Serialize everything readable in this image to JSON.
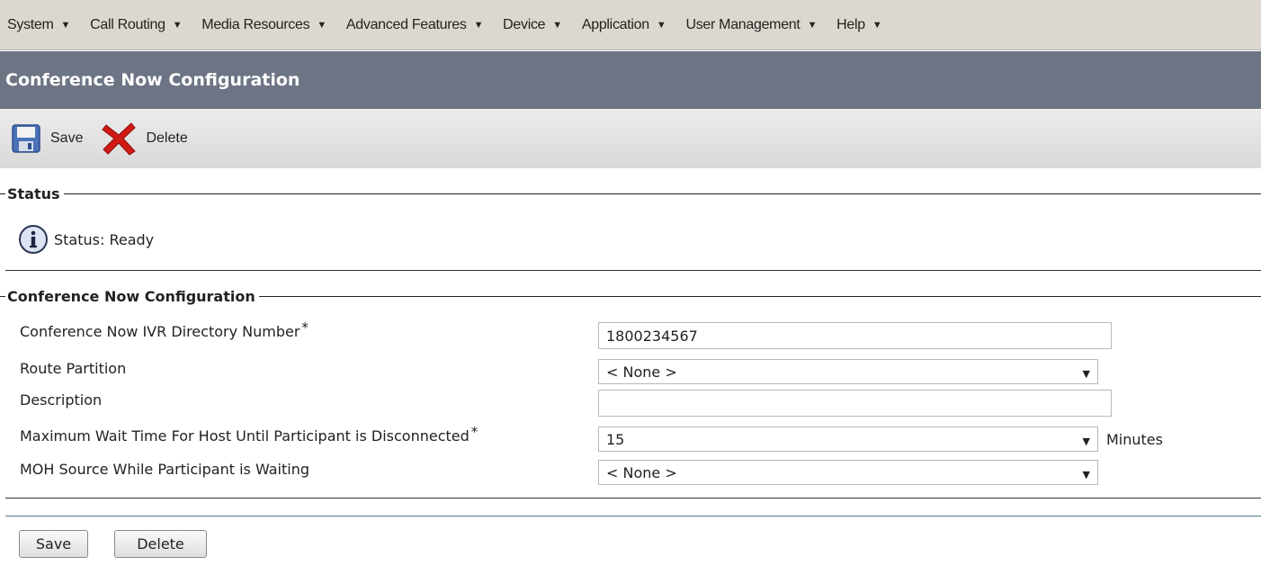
{
  "menubar": {
    "items": [
      {
        "label": "System"
      },
      {
        "label": "Call Routing"
      },
      {
        "label": "Media Resources"
      },
      {
        "label": "Advanced Features"
      },
      {
        "label": "Device"
      },
      {
        "label": "Application"
      },
      {
        "label": "User Management"
      },
      {
        "label": "Help"
      }
    ],
    "caret": "▼"
  },
  "page_title": "Conference Now Configuration",
  "toolbar": {
    "save_label": "Save",
    "delete_label": "Delete"
  },
  "status_section": {
    "legend": "Status",
    "status_text": "Status: Ready"
  },
  "config_section": {
    "legend": "Conference Now Configuration",
    "required_mark": "*",
    "fields": {
      "ivr_dn": {
        "label": "Conference Now IVR Directory Number",
        "value": "1800234567"
      },
      "route_partition": {
        "label": "Route Partition",
        "value": "< None >"
      },
      "description": {
        "label": "Description",
        "value": ""
      },
      "max_wait": {
        "label": "Maximum Wait Time For Host Until Participant is Disconnected",
        "value": "15",
        "unit": "Minutes"
      },
      "moh_source": {
        "label": "MOH Source While Participant is Waiting",
        "value": "< None >"
      }
    }
  },
  "bottom_buttons": {
    "save_label": "Save",
    "delete_label": "Delete"
  },
  "colors": {
    "title_bar": "#6d7585",
    "menu_bar": "#dcd8cf",
    "separator": "#4b7d84"
  }
}
